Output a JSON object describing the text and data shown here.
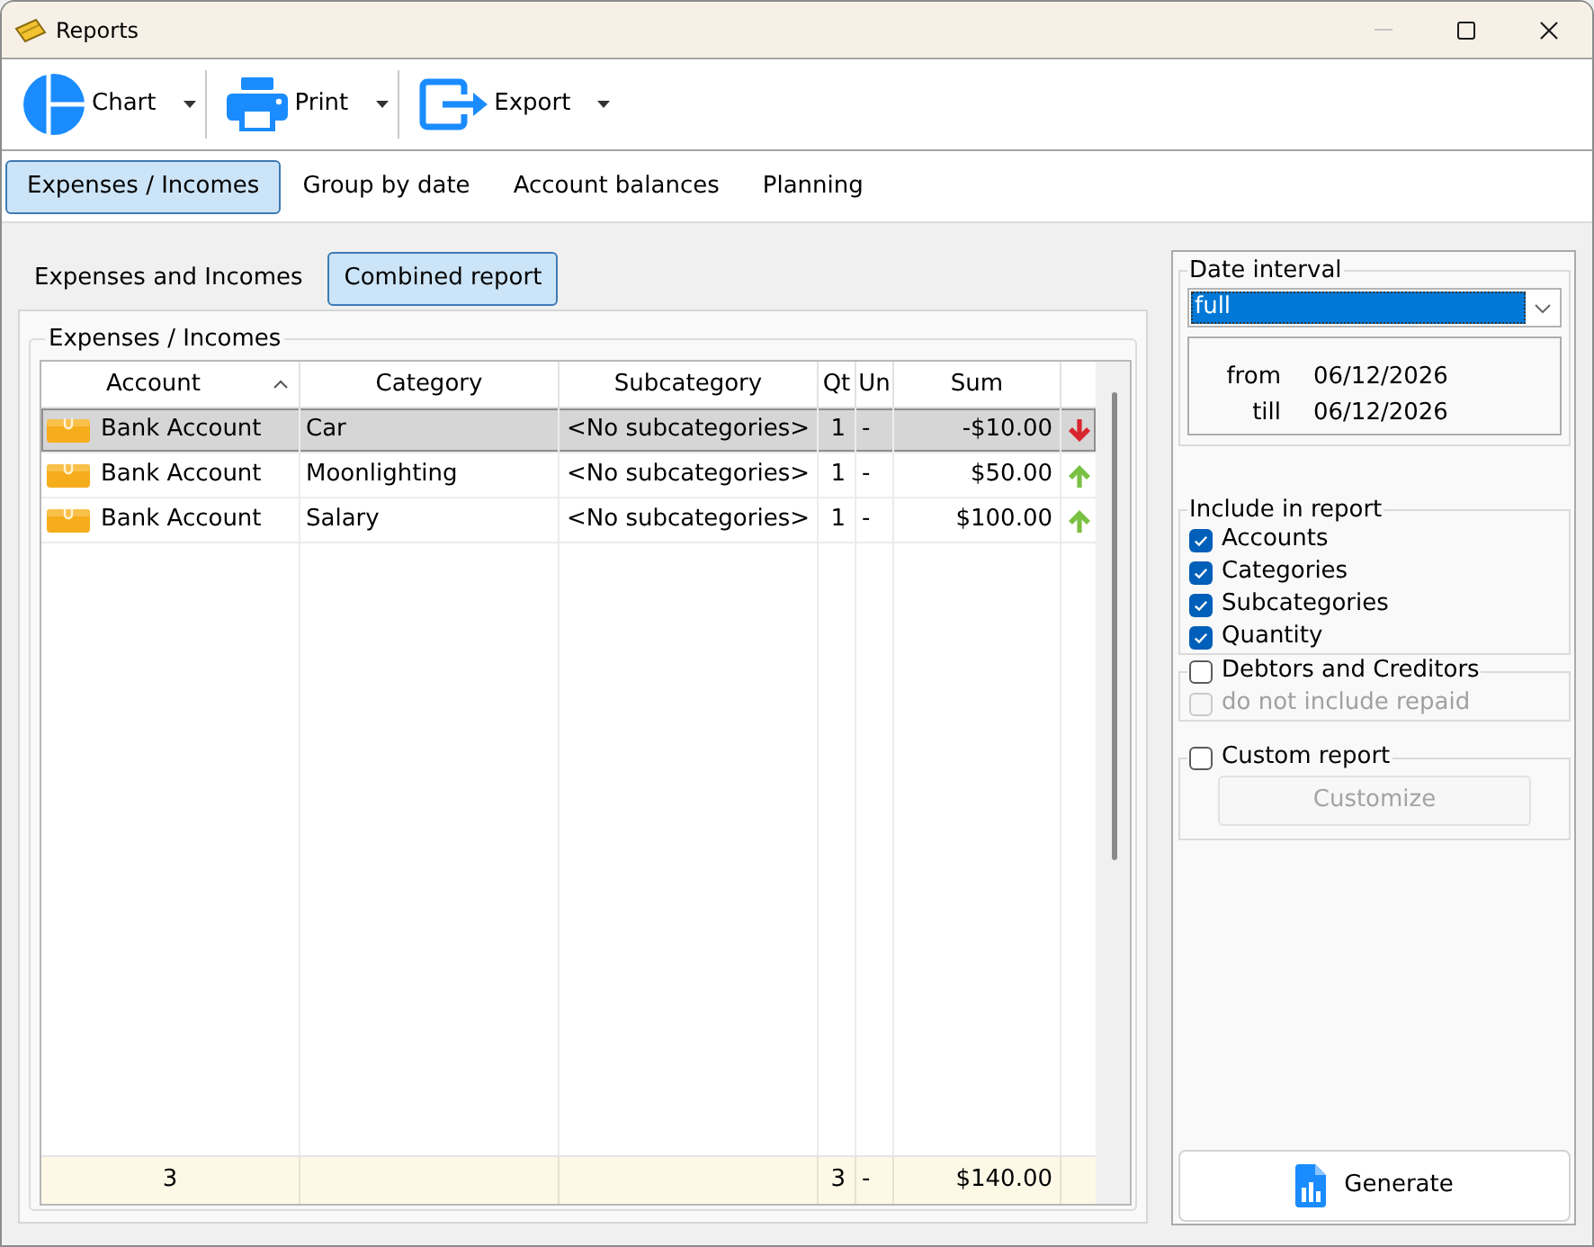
{
  "window": {
    "title": "Reports",
    "controls": [
      {
        "kind": "minimize",
        "disabled": true
      },
      {
        "kind": "maximize",
        "disabled": false
      },
      {
        "kind": "close",
        "disabled": false
      }
    ]
  },
  "toolbar": [
    {
      "kind": "chart",
      "label": "Chart",
      "dropdown": true
    },
    {
      "kind": "print",
      "label": "Print",
      "dropdown": true
    },
    {
      "kind": "export",
      "label": "Export",
      "dropdown": true
    }
  ],
  "tabs": [
    {
      "label": "Expenses / Incomes",
      "selected": true
    },
    {
      "label": "Group by date",
      "selected": false
    },
    {
      "label": "Account balances",
      "selected": false
    },
    {
      "label": "Planning",
      "selected": false
    }
  ],
  "report_tabs": [
    {
      "label": "Expenses and Incomes",
      "selected": false
    },
    {
      "label": "Combined report",
      "selected": true
    }
  ],
  "report": {
    "title": "Expenses / Incomes",
    "table": {
      "columns": [
        {
          "label": "Account",
          "sorted": true
        },
        {
          "label": "Category",
          "sorted": false
        },
        {
          "label": "Subcategory",
          "sorted": false
        },
        {
          "label": "Qt",
          "sorted": false
        },
        {
          "label": "Un",
          "sorted": false
        },
        {
          "label": "Sum",
          "sorted": false
        }
      ],
      "rows": [
        {
          "kind": "expense",
          "account": "Bank Account",
          "category": "Car",
          "subcategory": "<No subcategories>",
          "quantity": "1",
          "unit": "-",
          "sum": "-$10.00",
          "selected": true
        },
        {
          "kind": "income",
          "account": "Bank Account",
          "category": "Moonlighting",
          "subcategory": "<No subcategories>",
          "quantity": "1",
          "unit": "-",
          "sum": "$50.00",
          "selected": false
        },
        {
          "kind": "income",
          "account": "Bank Account",
          "category": "Salary",
          "subcategory": "<No subcategories>",
          "quantity": "1",
          "unit": "-",
          "sum": "$100.00",
          "selected": false
        }
      ],
      "totals": {
        "account": "3",
        "quantity": "3",
        "unit": "-",
        "sum": "$140.00"
      }
    }
  },
  "date_interval": {
    "title": "Date interval",
    "select": {
      "value": "full",
      "focused": true
    },
    "range": [
      {
        "label": "from",
        "date": "06/12/2026"
      },
      {
        "label": "till",
        "date": "06/12/2026"
      }
    ]
  },
  "include": {
    "title": "Include in report",
    "items": [
      {
        "label": "Accounts",
        "checked": true
      },
      {
        "label": "Categories",
        "checked": true
      },
      {
        "label": "Subcategories",
        "checked": true
      },
      {
        "label": "Quantity",
        "checked": true
      }
    ]
  },
  "debtors": {
    "label": "Debtors and Creditors",
    "checked": false,
    "options": [
      {
        "label": "do not include repaid",
        "checked": false,
        "disabled": true
      }
    ]
  },
  "custom_report": {
    "label": "Custom report",
    "checked": false,
    "button": {
      "label": "Customize",
      "disabled": true
    }
  },
  "generate_button": {
    "label": "Generate"
  }
}
